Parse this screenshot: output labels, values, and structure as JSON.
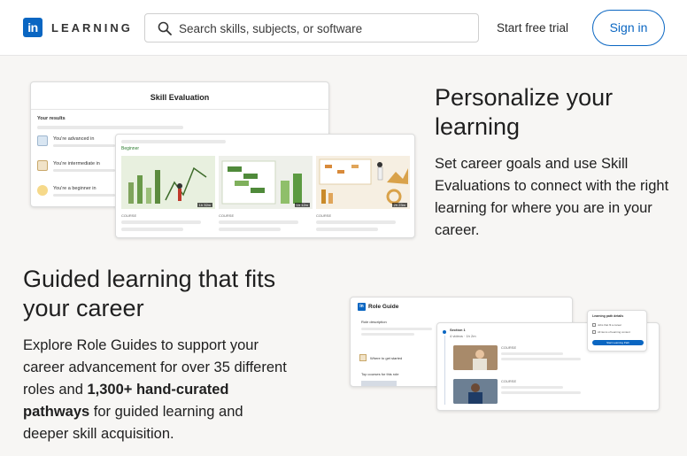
{
  "header": {
    "logo_text": "in",
    "logo_word": "LEARNING",
    "search_placeholder": "Search skills, subjects, or software",
    "start_trial": "Start free trial",
    "sign_in": "Sign in"
  },
  "personalize": {
    "heading": "Personalize your learning",
    "body": "Set career goals and use Skill Evaluations to connect with the right learning for where you are in your career."
  },
  "guided": {
    "heading": "Guided learning that fits your career",
    "body_part1": "Explore Role Guides to support your career advancement for over 35 different roles and ",
    "body_bold1": "1,300+ hand-curated pathways",
    "body_part2": " for guided learning and deeper skill acquisition."
  },
  "skill_eval": {
    "title": "Skill Evaluation",
    "results_label": "Your results",
    "rows": [
      "You're advanced in",
      "You're intermediate in",
      "You're a beginner in"
    ]
  },
  "courses_preview": {
    "level": "Beginner",
    "course_label": "COURSE",
    "durations": [
      "1h 32m",
      "1h 12m",
      "2h 23m"
    ]
  },
  "role_guide": {
    "title": "Role Guide",
    "role_description": "Role description",
    "where_to_start": "Where to get started",
    "top_courses": "Top courses for this role",
    "section_label": "Section 1",
    "section_meta": "4 videos · 1h 2m",
    "course_label": "COURSE",
    "lp_title": "Learning path details",
    "lp_line1": "Jobs that fit a career",
    "lp_line2": "All items of learning content",
    "lp_button": "Start Learning Path"
  },
  "colors": {
    "brand": "#0a66c2",
    "background": "#f7f6f4"
  }
}
